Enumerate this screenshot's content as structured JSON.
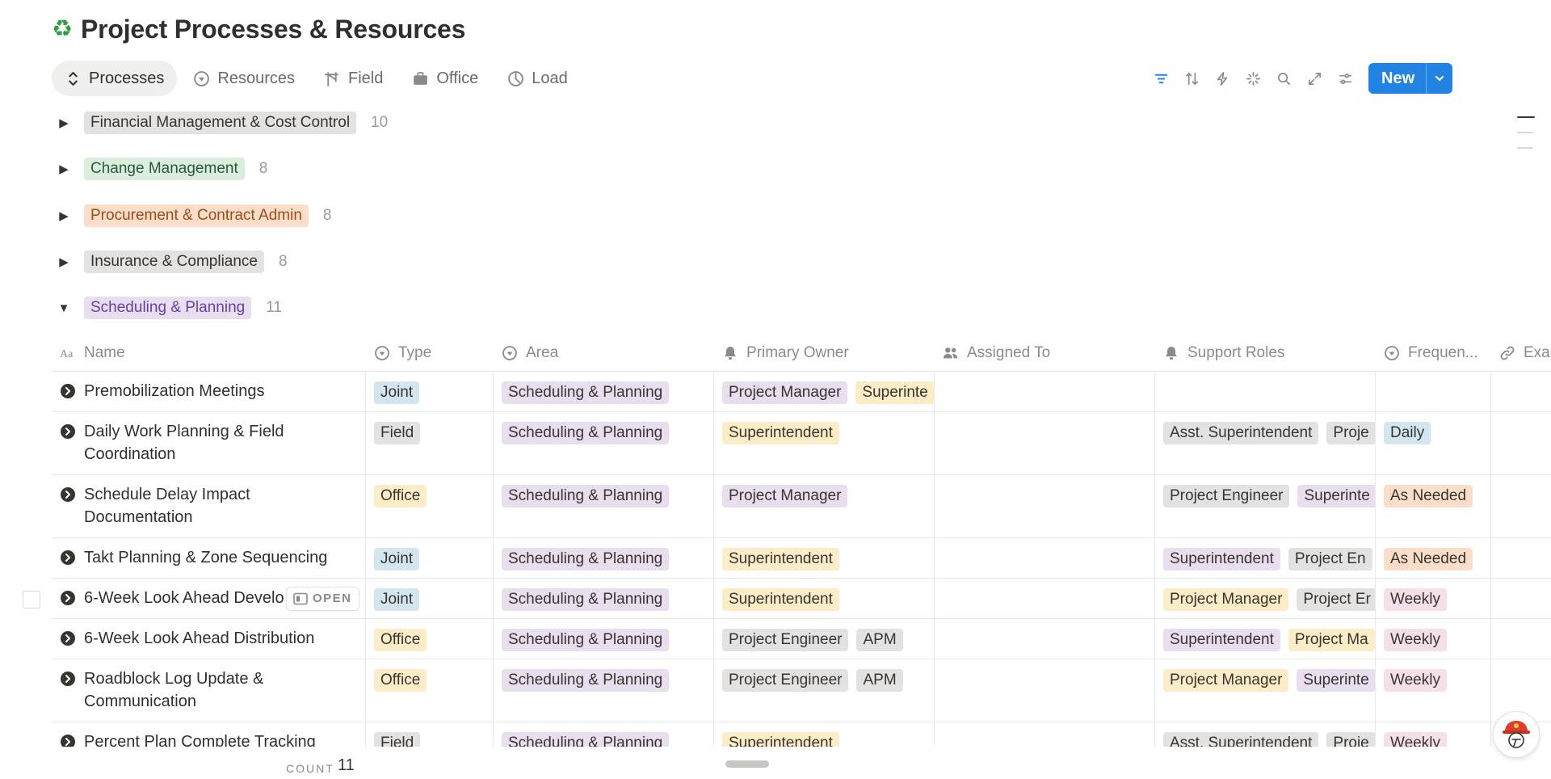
{
  "page": {
    "title_icon": "recycle-icon",
    "title": "Project Processes & Resources"
  },
  "tabs": [
    {
      "label": "Processes",
      "icon": "processes-icon",
      "active": true
    },
    {
      "label": "Resources",
      "icon": "resources-icon"
    },
    {
      "label": "Field",
      "icon": "field-icon"
    },
    {
      "label": "Office",
      "icon": "briefcase-icon"
    },
    {
      "label": "Load",
      "icon": "chart-pie-icon"
    }
  ],
  "toolbar": {
    "icons": [
      "filter-icon",
      "sort-icon",
      "automation-icon",
      "ai-icon",
      "search-icon",
      "expand-icon",
      "settings-icon"
    ],
    "new_label": "New"
  },
  "groups": [
    {
      "label": "Financial Management & Cost Control",
      "count": "10",
      "color": "#e3e2e0",
      "collapsed": true
    },
    {
      "label": "Change Management",
      "count": "8",
      "color": "#dbeddb",
      "collapsed": true
    },
    {
      "label": "Procurement & Contract Admin",
      "count": "8",
      "color": "#fadec9",
      "collapsed": true
    },
    {
      "label": "Insurance & Compliance",
      "count": "8",
      "color": "#e3e2e0",
      "collapsed": true
    },
    {
      "label": "Scheduling & Planning",
      "count": "11",
      "color": "#e8deee",
      "collapsed": false
    }
  ],
  "columns": {
    "name": "Name",
    "type": "Type",
    "area": "Area",
    "owner": "Primary Owner",
    "assigned": "Assigned To",
    "support": "Support Roles",
    "freq": "Frequen...",
    "ex": "Exa"
  },
  "rows": [
    {
      "name": "Premobilization Meetings",
      "type": "Joint",
      "area": "Scheduling & Planning",
      "owners": [
        "Project Manager",
        "Superinte"
      ],
      "support": [],
      "freq": ""
    },
    {
      "name": "Daily Work Planning & Field Coordination",
      "type": "Field",
      "area": "Scheduling & Planning",
      "owners": [
        "Superintendent"
      ],
      "support": [
        "Asst. Superintendent",
        "Proje"
      ],
      "freq": "Daily"
    },
    {
      "name": "Schedule Delay Impact Documentation",
      "type": "Office",
      "area": "Scheduling & Planning",
      "owners": [
        "Project Manager"
      ],
      "support": [
        "Project Engineer",
        "Superinte"
      ],
      "freq": "As Needed"
    },
    {
      "name": "Takt Planning & Zone Sequencing",
      "type": "Joint",
      "area": "Scheduling & Planning",
      "owners": [
        "Superintendent"
      ],
      "support": [
        "Superintendent",
        "Project En"
      ],
      "freq": "As Needed"
    },
    {
      "name": "6-Week Look Ahead Develo",
      "type": "Joint",
      "area": "Scheduling & Planning",
      "owners": [
        "Superintendent"
      ],
      "support": [
        "Project Manager",
        "Project Er"
      ],
      "freq": "Weekly",
      "open_label": "OPEN"
    },
    {
      "name": "6-Week Look Ahead Distribution",
      "type": "Office",
      "area": "Scheduling & Planning",
      "owners": [
        "Project Engineer",
        "APM"
      ],
      "support": [
        "Superintendent",
        "Project Ma"
      ],
      "freq": "Weekly"
    },
    {
      "name": "Roadblock Log Update & Communication",
      "type": "Office",
      "area": "Scheduling & Planning",
      "owners": [
        "Project Engineer",
        "APM"
      ],
      "support": [
        "Project Manager",
        "Superinte"
      ],
      "freq": "Weekly"
    },
    {
      "name": "Percent Plan Complete Tracking",
      "type": "Field",
      "area": "Scheduling & Planning",
      "owners": [
        "Superintendent"
      ],
      "support": [
        "Asst. Superintendent",
        "Proje"
      ],
      "freq": "Weekly"
    }
  ],
  "footer": {
    "count_label": "COUNT",
    "count_value": "11"
  }
}
